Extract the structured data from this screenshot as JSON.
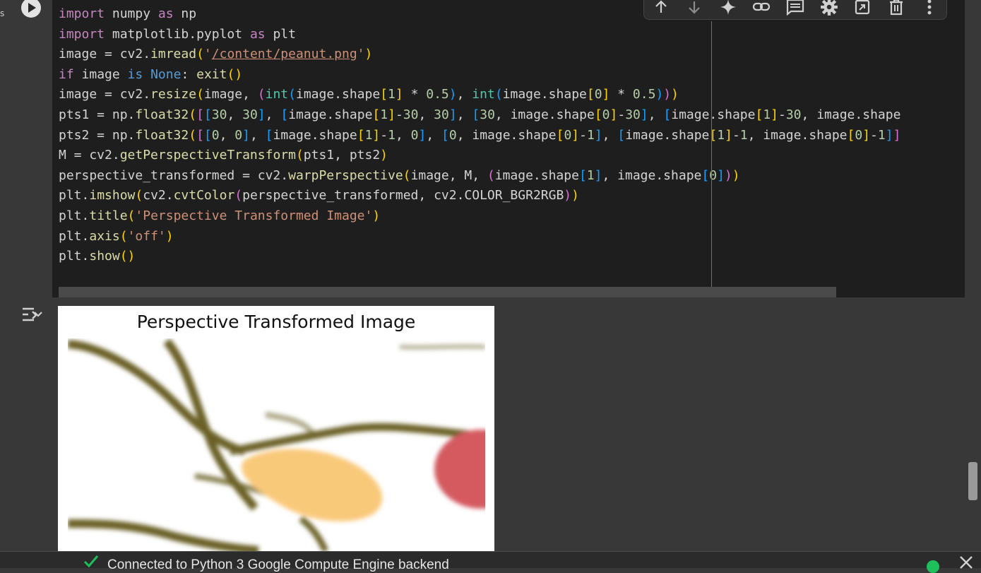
{
  "gutter": {
    "stray_char": "s"
  },
  "code_lines": [
    [
      [
        "import",
        "kw"
      ],
      [
        " numpy ",
        ""
      ],
      [
        "as",
        "kw"
      ],
      [
        " np",
        ""
      ]
    ],
    [
      [
        "import",
        "kw"
      ],
      [
        " matplotlib.pyplot ",
        ""
      ],
      [
        "as",
        "kw"
      ],
      [
        " plt",
        ""
      ]
    ],
    [
      [
        "image = cv2.",
        ""
      ],
      [
        "imread",
        "fn"
      ],
      [
        "(",
        "p1"
      ],
      [
        "'",
        "str"
      ],
      [
        "/content/peanut.png",
        "str path"
      ],
      [
        "'",
        "str"
      ],
      [
        ")",
        "p1"
      ]
    ],
    [
      [
        "if",
        "kw"
      ],
      [
        " image ",
        ""
      ],
      [
        "is",
        "bl"
      ],
      [
        " ",
        ""
      ],
      [
        "None",
        "bl"
      ],
      [
        ": ",
        ""
      ],
      [
        "exit",
        "fn"
      ],
      [
        "()",
        "p1"
      ]
    ],
    [
      [
        "image = cv2.",
        ""
      ],
      [
        "resize",
        "fn"
      ],
      [
        "(",
        "p1"
      ],
      [
        "image, ",
        ""
      ],
      [
        "(",
        "p2"
      ],
      [
        "int",
        "ty"
      ],
      [
        "(",
        "p3"
      ],
      [
        "image.shape",
        ""
      ],
      [
        "[",
        "p1"
      ],
      [
        "1",
        "num"
      ],
      [
        "]",
        "p1"
      ],
      [
        " * ",
        ""
      ],
      [
        "0.5",
        "num"
      ],
      [
        ")",
        "p3"
      ],
      [
        ", ",
        ""
      ],
      [
        "int",
        "ty"
      ],
      [
        "(",
        "p3"
      ],
      [
        "image.shape",
        ""
      ],
      [
        "[",
        "p1"
      ],
      [
        "0",
        "num"
      ],
      [
        "]",
        "p1"
      ],
      [
        " * ",
        ""
      ],
      [
        "0.5",
        "num"
      ],
      [
        ")",
        "p3"
      ],
      [
        ")",
        "p2"
      ],
      [
        ")",
        "p1"
      ]
    ],
    [
      [
        "pts1 = np.",
        ""
      ],
      [
        "float32",
        "fn"
      ],
      [
        "(",
        "p1"
      ],
      [
        "[",
        "p2"
      ],
      [
        "[",
        "p3"
      ],
      [
        "30",
        "num"
      ],
      [
        ", ",
        ""
      ],
      [
        "30",
        "num"
      ],
      [
        "]",
        "p3"
      ],
      [
        ", ",
        ""
      ],
      [
        "[",
        "p3"
      ],
      [
        "image.shape",
        ""
      ],
      [
        "[",
        "p1"
      ],
      [
        "1",
        "num"
      ],
      [
        "]",
        "p1"
      ],
      [
        "-",
        ""
      ],
      [
        "30",
        "num"
      ],
      [
        ", ",
        ""
      ],
      [
        "30",
        "num"
      ],
      [
        "]",
        "p3"
      ],
      [
        ", ",
        ""
      ],
      [
        "[",
        "p3"
      ],
      [
        "30",
        "num"
      ],
      [
        ", image.shape",
        ""
      ],
      [
        "[",
        "p1"
      ],
      [
        "0",
        "num"
      ],
      [
        "]",
        "p1"
      ],
      [
        "-",
        ""
      ],
      [
        "30",
        "num"
      ],
      [
        "]",
        "p3"
      ],
      [
        ", ",
        ""
      ],
      [
        "[",
        "p3"
      ],
      [
        "image.shape",
        ""
      ],
      [
        "[",
        "p1"
      ],
      [
        "1",
        "num"
      ],
      [
        "]",
        "p1"
      ],
      [
        "-",
        ""
      ],
      [
        "30",
        "num"
      ],
      [
        ", image.shape",
        ""
      ]
    ],
    [
      [
        "pts2 = np.",
        ""
      ],
      [
        "float32",
        "fn"
      ],
      [
        "(",
        "p1"
      ],
      [
        "[",
        "p2"
      ],
      [
        "[",
        "p3"
      ],
      [
        "0",
        "num"
      ],
      [
        ", ",
        ""
      ],
      [
        "0",
        "num"
      ],
      [
        "]",
        "p3"
      ],
      [
        ", ",
        ""
      ],
      [
        "[",
        "p3"
      ],
      [
        "image.shape",
        ""
      ],
      [
        "[",
        "p1"
      ],
      [
        "1",
        "num"
      ],
      [
        "]",
        "p1"
      ],
      [
        "-",
        ""
      ],
      [
        "1",
        "num"
      ],
      [
        ", ",
        ""
      ],
      [
        "0",
        "num"
      ],
      [
        "]",
        "p3"
      ],
      [
        ", ",
        ""
      ],
      [
        "[",
        "p3"
      ],
      [
        "0",
        "num"
      ],
      [
        ", image.shape",
        ""
      ],
      [
        "[",
        "p1"
      ],
      [
        "0",
        "num"
      ],
      [
        "]",
        "p1"
      ],
      [
        "-",
        ""
      ],
      [
        "1",
        "num"
      ],
      [
        "]",
        "p3"
      ],
      [
        ", ",
        ""
      ],
      [
        "[",
        "p3"
      ],
      [
        "image.shape",
        ""
      ],
      [
        "[",
        "p1"
      ],
      [
        "1",
        "num"
      ],
      [
        "]",
        "p1"
      ],
      [
        "-",
        ""
      ],
      [
        "1",
        "num"
      ],
      [
        ", image.shape",
        ""
      ],
      [
        "[",
        "p1"
      ],
      [
        "0",
        "num"
      ],
      [
        "]",
        "p1"
      ],
      [
        "-",
        ""
      ],
      [
        "1",
        "num"
      ],
      [
        "]",
        "p3"
      ],
      [
        "]",
        "p2"
      ]
    ],
    [
      [
        "M = cv2.",
        ""
      ],
      [
        "getPerspectiveTransform",
        "fn"
      ],
      [
        "(",
        "p1"
      ],
      [
        "pts1, pts2",
        ""
      ],
      [
        ")",
        "p1"
      ]
    ],
    [
      [
        "perspective_transformed = cv2.",
        ""
      ],
      [
        "warpPerspective",
        "fn"
      ],
      [
        "(",
        "p1"
      ],
      [
        "image, M, ",
        ""
      ],
      [
        "(",
        "p2"
      ],
      [
        "image.shape",
        ""
      ],
      [
        "[",
        "p3"
      ],
      [
        "1",
        "num"
      ],
      [
        "]",
        "p3"
      ],
      [
        ", image.shape",
        ""
      ],
      [
        "[",
        "p3"
      ],
      [
        "0",
        "num"
      ],
      [
        "]",
        "p3"
      ],
      [
        ")",
        "p2"
      ],
      [
        ")",
        "p1"
      ]
    ],
    [
      [
        "plt.",
        ""
      ],
      [
        "imshow",
        "fn"
      ],
      [
        "(",
        "p1"
      ],
      [
        "cv2.",
        ""
      ],
      [
        "cvtColor",
        "fn"
      ],
      [
        "(",
        "p2"
      ],
      [
        "perspective_transformed, cv2.COLOR_BGR2RGB",
        ""
      ],
      [
        ")",
        "p2"
      ],
      [
        ")",
        "p1"
      ]
    ],
    [
      [
        "plt.",
        ""
      ],
      [
        "title",
        "fn"
      ],
      [
        "(",
        "p1"
      ],
      [
        "'Perspective Transformed Image'",
        "str"
      ],
      [
        ")",
        "p1"
      ]
    ],
    [
      [
        "plt.",
        ""
      ],
      [
        "axis",
        "fn"
      ],
      [
        "(",
        "p1"
      ],
      [
        "'off'",
        "str"
      ],
      [
        ")",
        "p1"
      ]
    ],
    [
      [
        "plt.",
        ""
      ],
      [
        "show",
        "fn"
      ],
      [
        "()",
        "p1"
      ]
    ]
  ],
  "toolbar": {
    "buttons": [
      {
        "name": "move-up-button",
        "icon": "arrow-up-icon"
      },
      {
        "name": "move-down-button",
        "icon": "arrow-down-icon"
      },
      {
        "name": "gemini-button",
        "icon": "sparkle-icon"
      },
      {
        "name": "copy-link-button",
        "icon": "link-icon"
      },
      {
        "name": "add-comment-button",
        "icon": "comment-icon"
      },
      {
        "name": "settings-button",
        "icon": "gear-icon"
      },
      {
        "name": "mirror-cell-button",
        "icon": "mirror-tab-icon"
      },
      {
        "name": "delete-button",
        "icon": "trash-icon"
      },
      {
        "name": "more-button",
        "icon": "more-vert-icon"
      }
    ]
  },
  "output": {
    "plot_title": "Perspective Transformed Image",
    "colors": {
      "branch": "#6b6127",
      "peanut": "#f9c97a",
      "berry": "#d45a60",
      "background": "#ffffff"
    }
  },
  "status": {
    "text": "Connected to Python 3 Google Compute Engine backend",
    "dot_color": "#1ec05c"
  }
}
